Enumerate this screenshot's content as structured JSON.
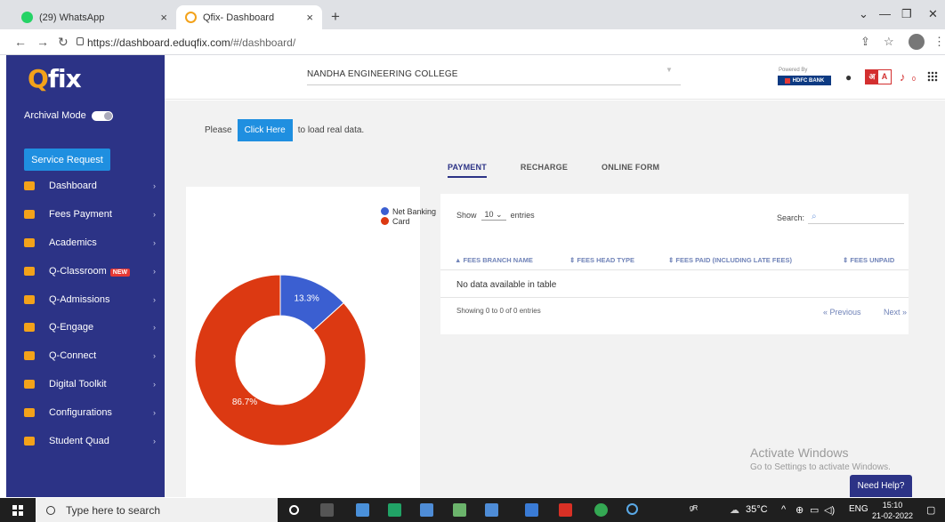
{
  "browser": {
    "tabs": [
      {
        "label": "(29) WhatsApp",
        "active": false
      },
      {
        "label": "Qfix- Dashboard",
        "active": true
      }
    ],
    "close_glyph": "×",
    "new_tab_glyph": "+",
    "url_host": "https://dashboard.eduqfix.com",
    "url_path": "/#/dashboard/",
    "controls": {
      "minimize": "—",
      "restore": "❐",
      "close": "✕",
      "collapse": "⌄"
    }
  },
  "sidebar": {
    "logo_q": "Q",
    "logo_rest": "fix",
    "archival_label": "Archival Mode",
    "service_button": "Service Request",
    "items": [
      {
        "label": "Dashboard",
        "icon": "dashboard-icon"
      },
      {
        "label": "Fees Payment",
        "icon": "fees-icon"
      },
      {
        "label": "Academics",
        "icon": "academics-icon"
      },
      {
        "label": "Q-Classroom",
        "icon": "classroom-icon",
        "badge": "NEW"
      },
      {
        "label": "Q-Admissions",
        "icon": "admissions-icon"
      },
      {
        "label": "Q-Engage",
        "icon": "engage-icon"
      },
      {
        "label": "Q-Connect",
        "icon": "connect-icon"
      },
      {
        "label": "Digital Toolkit",
        "icon": "toolkit-icon"
      },
      {
        "label": "Configurations",
        "icon": "gear-icon"
      },
      {
        "label": "Student Quad",
        "icon": "cart-icon"
      }
    ]
  },
  "header": {
    "college": "NANDHA ENGINEERING COLLEGE",
    "powered_by": "Powered By",
    "bank": "HDFC BANK",
    "lang_a": "अ",
    "lang_b": "A",
    "notif_count": "0"
  },
  "notice": {
    "prefix": "Please",
    "button": "Click Here",
    "suffix": "to load real data."
  },
  "payment_tabs": [
    "PAYMENT",
    "RECHARGE",
    "ONLINE FORM"
  ],
  "chart_data": {
    "type": "pie",
    "categories": [
      "Net Banking",
      "Card"
    ],
    "values": [
      13.3,
      86.7
    ],
    "labels": [
      "13.3%",
      "86.7%"
    ],
    "colors": [
      "#3b5fd1",
      "#dc3912"
    ],
    "legend": "top-right",
    "title": ""
  },
  "table": {
    "show_prefix": "Show",
    "show_value": "10",
    "show_suffix": "entries",
    "search_label": "Search:",
    "columns": [
      "FEES BRANCH NAME",
      "FEES HEAD TYPE",
      "FEES PAID (INCLUDING LATE FEES)",
      "FEES UNPAID"
    ],
    "empty": "No data available in table",
    "info": "Showing 0 to 0 of 0 entries",
    "prev": "Previous",
    "next": "Next"
  },
  "watermark": {
    "title": "Activate Windows",
    "subtitle": "Go to Settings to activate Windows."
  },
  "help": "Need Help?",
  "taskbar": {
    "search_placeholder": "Type here to search",
    "temperature": "35°C",
    "language": "ENG",
    "time": "15:10",
    "date": "21-02-2022"
  }
}
